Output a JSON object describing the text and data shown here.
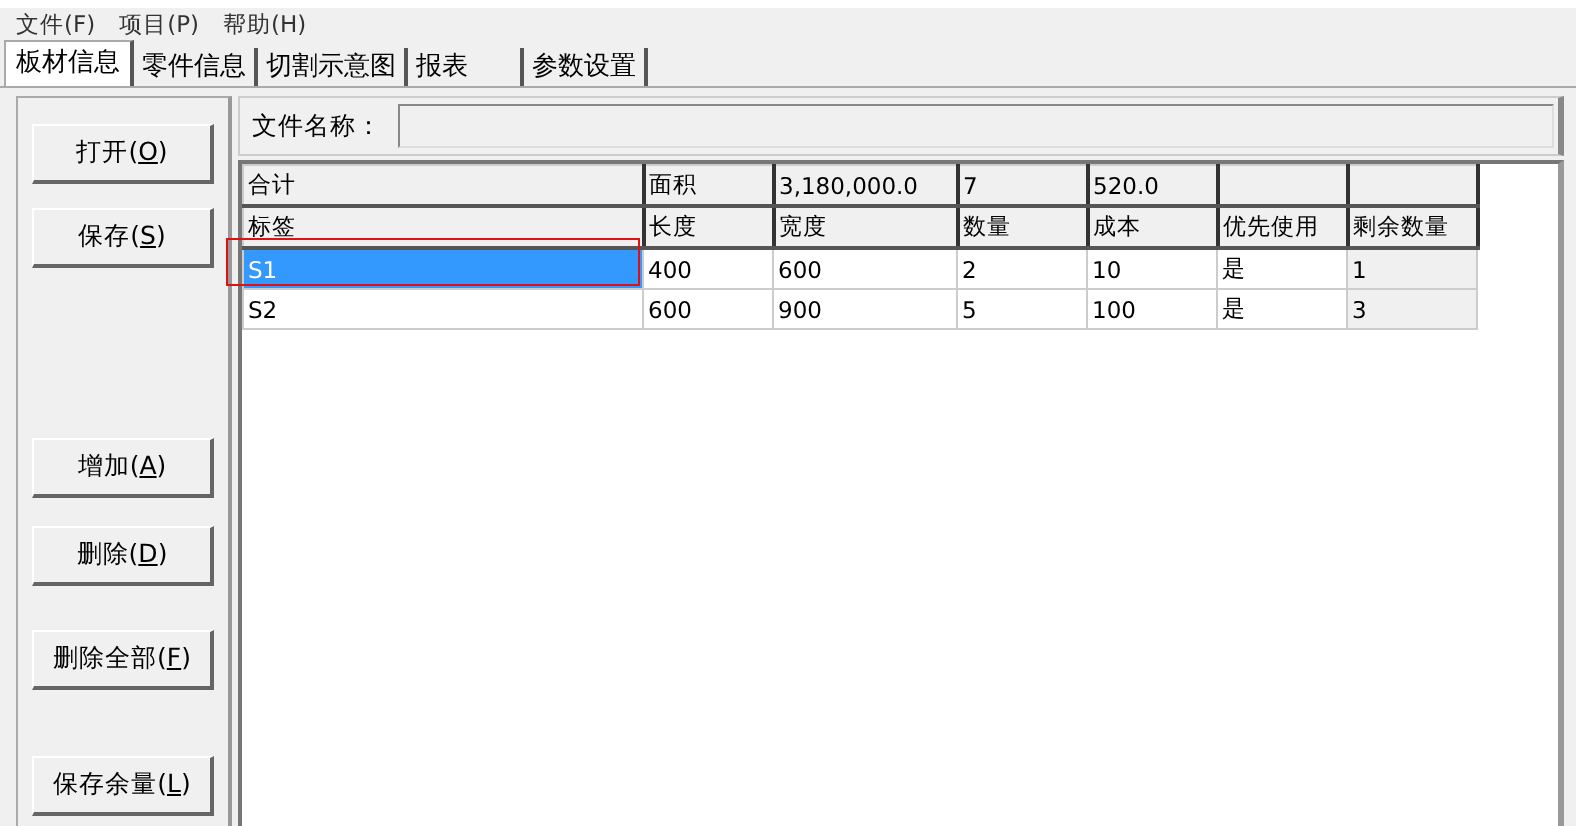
{
  "menu": [
    {
      "label": "文件(F)"
    },
    {
      "label": "项目(P)"
    },
    {
      "label": "帮助(H)"
    }
  ],
  "tabs": [
    {
      "label": "板材信息",
      "selected": true
    },
    {
      "label": "零件信息",
      "selected": false
    },
    {
      "label": "切割示意图",
      "selected": false
    },
    {
      "label": "报表",
      "selected": false
    },
    {
      "label": "参数设置",
      "selected": false
    }
  ],
  "buttons": [
    {
      "before": "打开(",
      "accel": "O",
      "after": ")"
    },
    {
      "before": "保存(",
      "accel": "S",
      "after": ")"
    },
    {
      "before": "增加(",
      "accel": "A",
      "after": ")"
    },
    {
      "before": "删除(",
      "accel": "D",
      "after": ")"
    },
    {
      "before": "删除全部(",
      "accel": "F",
      "after": ")"
    },
    {
      "before": "保存余量(",
      "accel": "L",
      "after": ")"
    }
  ],
  "file_name": {
    "label": "文件名称："
  },
  "table": {
    "summary": [
      "合计",
      "面积",
      "3,180,000.0",
      "7",
      "520.0"
    ],
    "columns": [
      "标签",
      "长度",
      "宽度",
      "数量",
      "成本",
      "优先使用",
      "剩余数量"
    ],
    "rows": [
      {
        "selected": true,
        "cells": [
          "S1",
          "400",
          "600",
          "2",
          "10",
          "是",
          "1"
        ]
      },
      {
        "selected": false,
        "cells": [
          "S2",
          "600",
          "900",
          "5",
          "100",
          "是",
          "3"
        ]
      }
    ]
  }
}
